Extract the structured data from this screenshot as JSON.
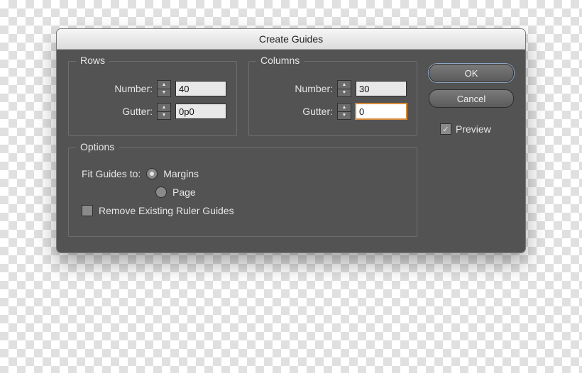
{
  "title": "Create Guides",
  "rows": {
    "legend": "Rows",
    "number_label": "Number:",
    "number_value": "40",
    "gutter_label": "Gutter:",
    "gutter_value": "0p0"
  },
  "columns": {
    "legend": "Columns",
    "number_label": "Number:",
    "number_value": "30",
    "gutter_label": "Gutter:",
    "gutter_value": "0"
  },
  "options": {
    "legend": "Options",
    "fit_label": "Fit Guides to:",
    "margins_label": "Margins",
    "page_label": "Page",
    "fit_selected": "margins",
    "remove_label": "Remove Existing Ruler Guides",
    "remove_checked": false
  },
  "buttons": {
    "ok": "OK",
    "cancel": "Cancel"
  },
  "preview": {
    "label": "Preview",
    "checked": true
  }
}
